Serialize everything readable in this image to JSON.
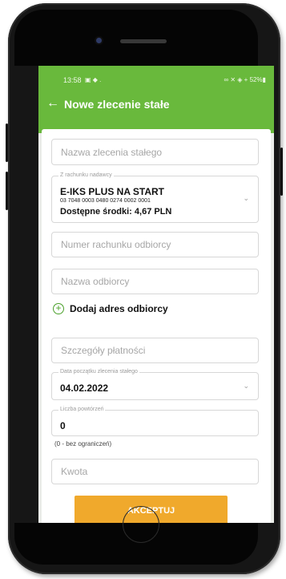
{
  "statusbar": {
    "time": "13:58",
    "left_icons": "▣ ◆ .",
    "right_status": "∞ ✕ ◈ + 52%▮"
  },
  "appbar": {
    "back_icon": "←",
    "title": "Nowe zlecenie stałe"
  },
  "form": {
    "order_name_placeholder": "Nazwa zlecenia stałego",
    "from_account": {
      "legend": "Z rachunku nadawcy",
      "account_name": "E-IKS PLUS NA START",
      "account_number": "03 7048 0003 0480 0274 0002 0001",
      "available_funds": "Dostępne środki: 4,67 PLN"
    },
    "recipient_account_placeholder": "Numer rachunku odbiorcy",
    "recipient_name_placeholder": "Nazwa odbiorcy",
    "add_address": "Dodaj adres odbiorcy",
    "payment_details_placeholder": "Szczegóły płatności",
    "start_date": {
      "legend": "Data początku zlecenia stałego",
      "value": "04.02.2022"
    },
    "repetitions": {
      "legend": "Liczba powtórzeń",
      "value": "0",
      "hint": "(0 - bez ograniczeń)"
    },
    "amount_placeholder": "Kwota",
    "accept_label": "AKCEPTUJ"
  },
  "colors": {
    "header_green": "#69b93c",
    "accent_orange": "#f0a92c",
    "plus_green": "#4aa02a"
  }
}
